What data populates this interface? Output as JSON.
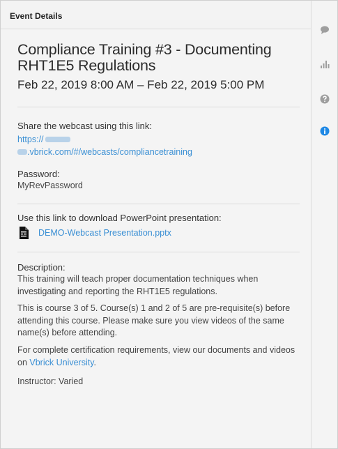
{
  "panel": {
    "header_title": "Event Details"
  },
  "event": {
    "title": "Compliance Training #3 - Documenting RHT1E5 Regulations",
    "datetime": "Feb 22, 2019 8:00 AM – Feb 22, 2019 5:00 PM"
  },
  "share": {
    "label": "Share the webcast using this link:",
    "link_line1": "https://",
    "link_line2": ".vbrick.com/#/webcasts/compliancetraining"
  },
  "password": {
    "label": "Password:",
    "value": "MyRevPassword"
  },
  "download": {
    "label": "Use this link to download PowerPoint presentation:",
    "file_name": "DEMO-Webcast Presentation.pptx"
  },
  "description": {
    "label": "Description:",
    "p1": "This training will teach proper documentation techniques when investigating and reporting the RHT1E5 regulations.",
    "p2": "This is course 3 of 5.  Course(s) 1 and 2 of 5 are pre-requisite(s) before attending this course. Please make sure you view videos of the same name(s) before attending.",
    "p3_before": "For complete certification requirements, view our documents and videos on ",
    "p3_link": "Vbrick University",
    "p3_after": ".",
    "instructor": "Instructor: Varied"
  },
  "rail": {
    "icons": [
      "chat-icon",
      "poll-chart-icon",
      "help-icon",
      "info-icon"
    ],
    "active_color": "#1e88e5",
    "inactive_color": "#9e9e9e"
  },
  "colors": {
    "link": "#3a8fd4",
    "panel_bg": "#f4f4f4"
  }
}
